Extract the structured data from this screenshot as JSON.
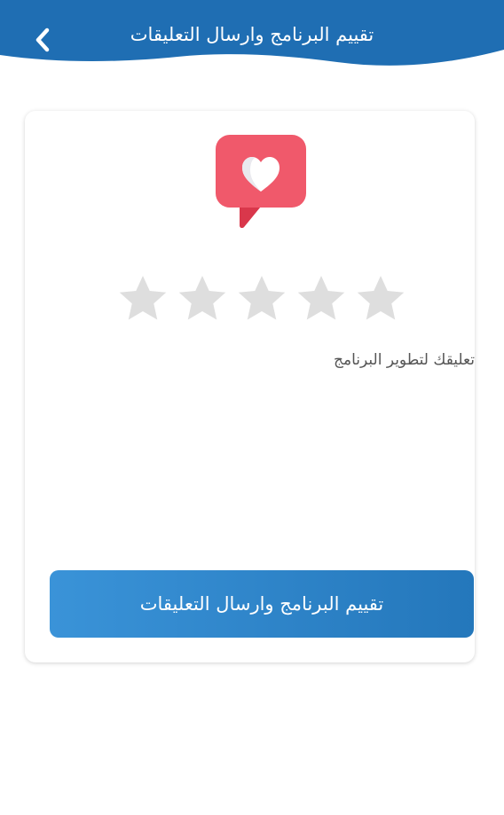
{
  "header": {
    "title": "تقييم البرنامج وارسال التعليقات",
    "back_icon": "chevron-left-icon",
    "background_color": "#1f6eb3"
  },
  "card": {
    "icon": "heart-chat-bubble-icon",
    "rating": {
      "max_stars": 5,
      "selected": 0,
      "star_color_inactive": "#dedede"
    },
    "comment_label": "تعليقك لتطوير البرنامج",
    "comment_value": "",
    "submit_label": "تقييم البرنامج وارسال التعليقات",
    "submit_color": "#2a80c4"
  }
}
